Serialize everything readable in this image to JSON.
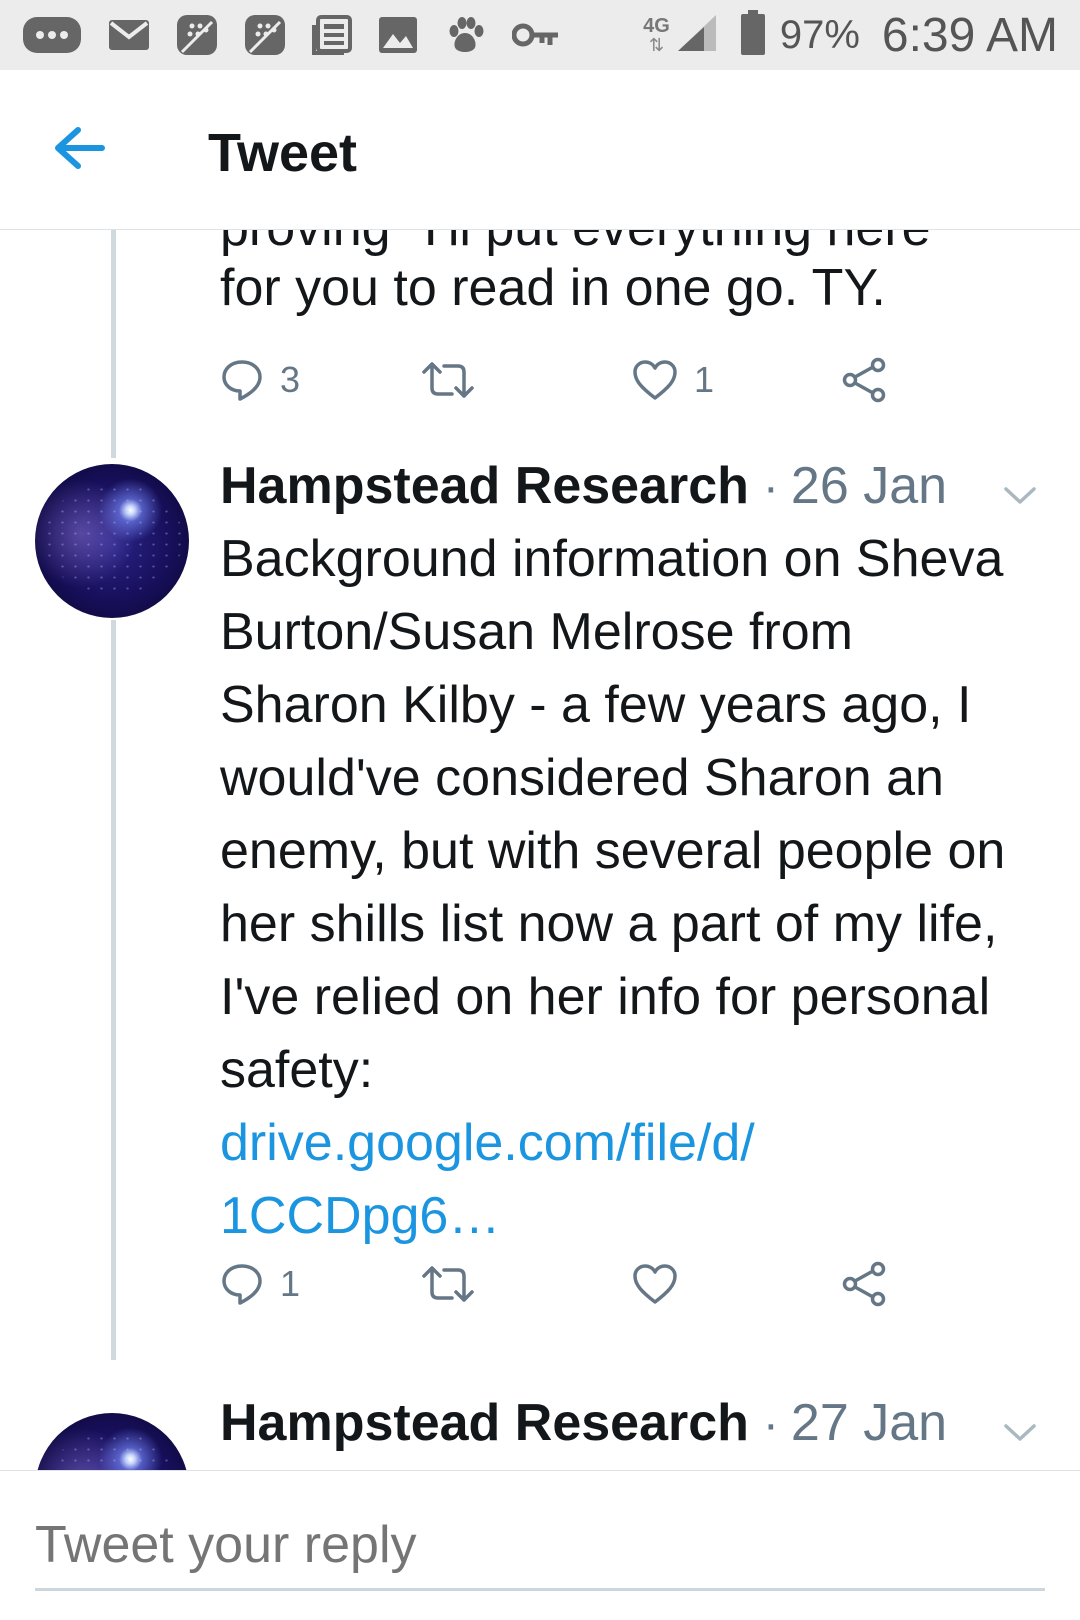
{
  "status_bar": {
    "icons": [
      "more-icon",
      "mail-icon",
      "blackberry-icon",
      "blackberry-icon",
      "news-icon",
      "image-icon",
      "paw-icon",
      "key-icon",
      "network-4g-lte-icon",
      "signal-icon",
      "battery-icon"
    ],
    "network": "4G",
    "battery_percent": "97%",
    "time": "6:39 AM"
  },
  "header": {
    "back_icon": "arrow-left-icon",
    "title": "Tweet"
  },
  "colors": {
    "accent": "#1b95e0",
    "text": "#14171a",
    "muted": "#657786",
    "thread_line": "#cfd9de"
  },
  "tweets": [
    {
      "partial_top_line": "proving \"I'll put everything here",
      "text_last_line": "for you to read in one go. TY.",
      "reply_count": "3",
      "retweet_count": "",
      "like_count": "1"
    },
    {
      "author": "Hampstead Research",
      "separator": "·",
      "date": "26 Jan",
      "text": "Background information on Sheva Burton/Susan Melrose from Sharon Kilby - a few years ago, I would've considered Sharon an enemy, but with several people on her shills list now a part of my life, I've relied on her info for personal safety:",
      "link_line1": "drive.google.com/file/d/",
      "link_line2": "1CCDpg6…",
      "reply_count": "1",
      "retweet_count": "",
      "like_count": ""
    },
    {
      "author": "Hampstead Research",
      "separator": "·",
      "date": "27 Jan"
    }
  ],
  "reply_bar": {
    "placeholder": "Tweet your reply"
  }
}
